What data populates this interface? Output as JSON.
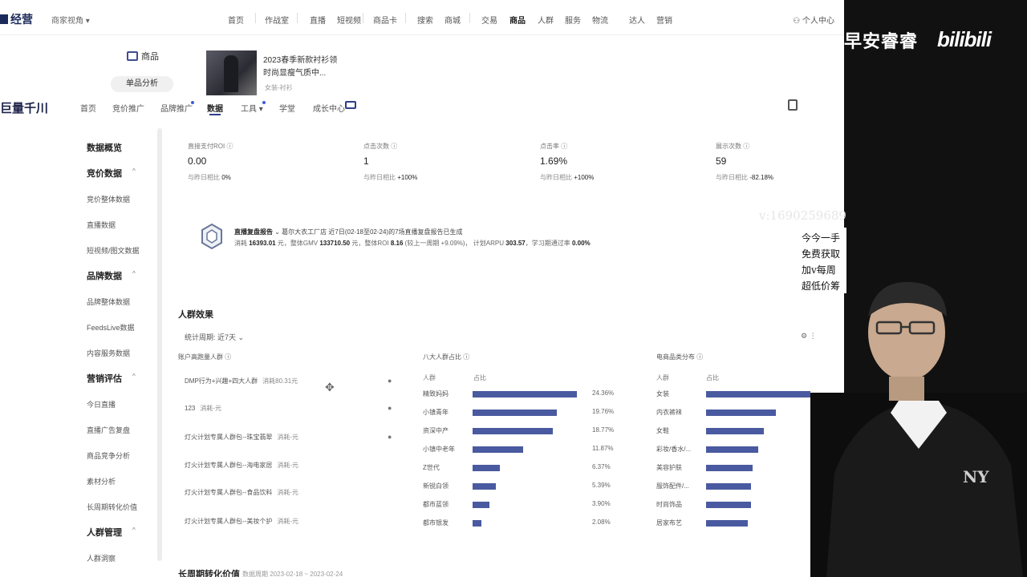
{
  "top_nav": {
    "brand": "经营",
    "selector": "商家视角 ▾",
    "items": [
      "首页",
      "作战室",
      "直播",
      "短视频",
      "商品卡",
      "搜索",
      "商城",
      "交易",
      "商品",
      "人群",
      "服务",
      "物流",
      "达人",
      "营销"
    ],
    "active": "商品",
    "personal": "个人中心"
  },
  "product": {
    "tag": "商品",
    "analysis_btn": "单品分析",
    "title_line1": "2023春季新款衬衫领",
    "title_line2": "时尚显瘦气质中...",
    "category": "女装-衬衫"
  },
  "sub_nav": {
    "logo": "巨量千川",
    "items": [
      "首页",
      "竞价推广",
      "品牌推广",
      "数据",
      "工具 ▾",
      "学堂",
      "成长中心"
    ],
    "active": "数据"
  },
  "sidebar": {
    "overview": "数据概览",
    "groups": [
      {
        "title": "竞价数据",
        "items": [
          "竞价整体数据",
          "直播数据",
          "短视频/图文数据"
        ]
      },
      {
        "title": "品牌数据",
        "items": [
          "品牌整体数据",
          "FeedsLive数据",
          "内容服务数据"
        ]
      },
      {
        "title": "营销评估",
        "items": [
          "今日直播",
          "直播广告复盘",
          "商品竞争分析",
          "素材分析",
          "长周期转化价值"
        ]
      },
      {
        "title": "人群管理",
        "items": [
          "人群洞察"
        ]
      }
    ]
  },
  "metrics": [
    {
      "label": "直接支付ROI",
      "value": "0.00",
      "cmp_label": "与昨日相比",
      "cmp_value": "0%"
    },
    {
      "label": "点击次数",
      "value": "1",
      "cmp_label": "与昨日相比",
      "cmp_value": "+100%"
    },
    {
      "label": "点击率",
      "value": "1.69%",
      "cmp_label": "与昨日相比",
      "cmp_value": "+100%"
    },
    {
      "label": "展示次数",
      "value": "59",
      "cmp_label": "与昨日相比",
      "cmp_value": "-82.18%"
    }
  ],
  "report": {
    "title": "直播复盘报告",
    "subtitle": "葛尔大衣工厂店  近7日(02-18至02-24)的7场直播复盘报告已生成",
    "spend_label": "消耗",
    "spend": "16393.01",
    "gmv_label": "元，整体GMV",
    "gmv": "133710.50",
    "roi_label": "元，整体ROI",
    "roi": "8.16",
    "roi_cmp": "(较上一周期 +9.09%)，",
    "arpu_label": "计划ARPU",
    "arpu": "303.57",
    "rate_label": "，学习期通过率",
    "rate": "0.00%"
  },
  "crowd": {
    "title": "人群效果",
    "period": "统计周期: 近7天  ⌄",
    "accounts_title": "账户高跑量人群",
    "accounts": [
      {
        "name": "DMP行为+兴趣+四大人群",
        "spend": "消耗80.31元"
      },
      {
        "name": "123",
        "spend": "消耗-元"
      },
      {
        "name": "灯火计划专属人群包--珠宝翡翠",
        "spend": "消耗-元"
      },
      {
        "name": "灯火计划专属人群包--海电家居",
        "spend": "消耗-元"
      },
      {
        "name": "灯火计划专属人群包--食品饮料",
        "spend": "消耗-元"
      },
      {
        "name": "灯火计划专属人群包--美妆个护",
        "spend": "消耗-元"
      }
    ],
    "eight_title": "八大人群占比",
    "eight_head": [
      "人群",
      "占比"
    ],
    "eight": [
      {
        "name": "精致妈妈",
        "pct": "24.36%",
        "share": 0.2436
      },
      {
        "name": "小镇青年",
        "pct": "19.76%",
        "share": 0.1976
      },
      {
        "name": "资深中产",
        "pct": "18.77%",
        "share": 0.1877
      },
      {
        "name": "小镇中老年",
        "pct": "11.87%",
        "share": 0.1187
      },
      {
        "name": "Z世代",
        "pct": "6.37%",
        "share": 0.0637
      },
      {
        "name": "新锐白领",
        "pct": "5.39%",
        "share": 0.0539
      },
      {
        "name": "都市蓝领",
        "pct": "3.90%",
        "share": 0.039
      },
      {
        "name": "都市银发",
        "pct": "2.08%",
        "share": 0.0208
      }
    ],
    "cat_title": "电商品类分布",
    "cat_head": [
      "人群",
      "占比"
    ],
    "cats": [
      {
        "name": "女装",
        "share": 0.36
      },
      {
        "name": "内衣裤袜",
        "share": 0.24
      },
      {
        "name": "女鞋",
        "share": 0.2
      },
      {
        "name": "彩妆/香水/...",
        "share": 0.18
      },
      {
        "name": "美容护肤",
        "share": 0.16
      },
      {
        "name": "服饰配件/...",
        "share": 0.155
      },
      {
        "name": "时尚饰品",
        "share": 0.155
      },
      {
        "name": "居家布艺",
        "share": 0.145
      }
    ]
  },
  "long_cycle": {
    "title": "长周期转化价值",
    "date": "数据周期 2023-02-18 ~ 2023-02-24"
  },
  "overlay": {
    "title": "早安睿睿",
    "logo": "bilibili",
    "contact": "v:1690259689",
    "promo": [
      "今今一手",
      "免费获取",
      "加v每周",
      "超低价筹"
    ]
  }
}
